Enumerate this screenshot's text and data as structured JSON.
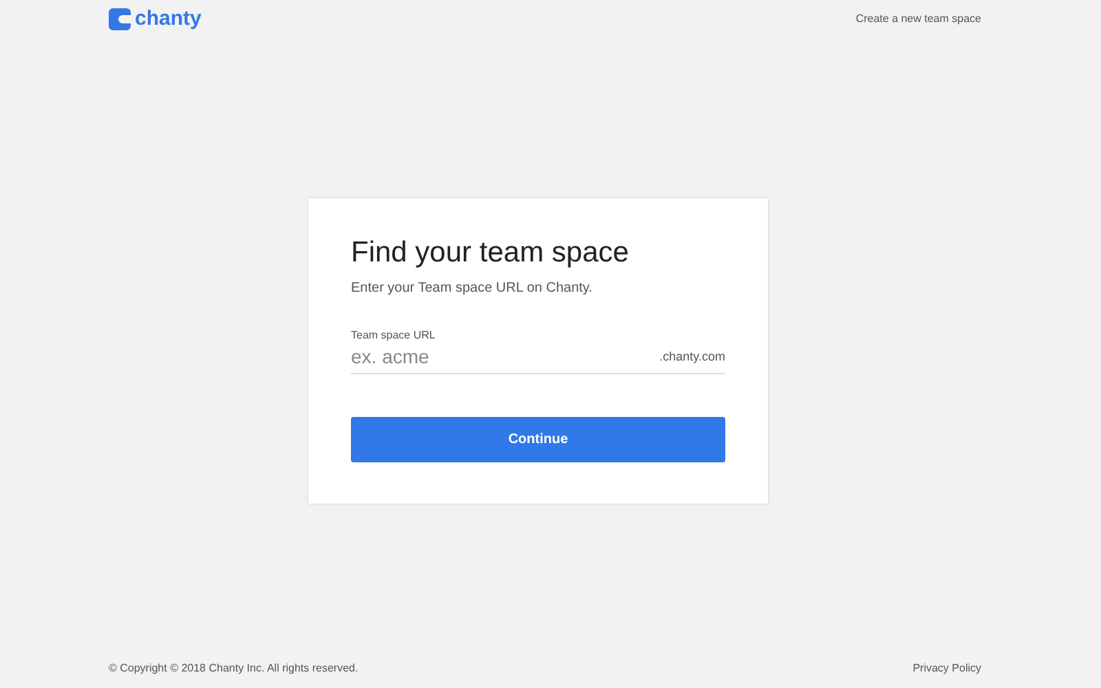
{
  "header": {
    "logo_text": "chanty",
    "link": "Create a new team space"
  },
  "card": {
    "title": "Find your team space",
    "subtitle": "Enter your Team space URL on Chanty.",
    "field": {
      "label": "Team space URL",
      "placeholder": "ex. acme",
      "suffix": ".chanty.com"
    },
    "button": "Continue"
  },
  "footer": {
    "copyright": "© Copyright © 2018 Chanty Inc. All rights reserved.",
    "link": "Privacy Policy"
  }
}
